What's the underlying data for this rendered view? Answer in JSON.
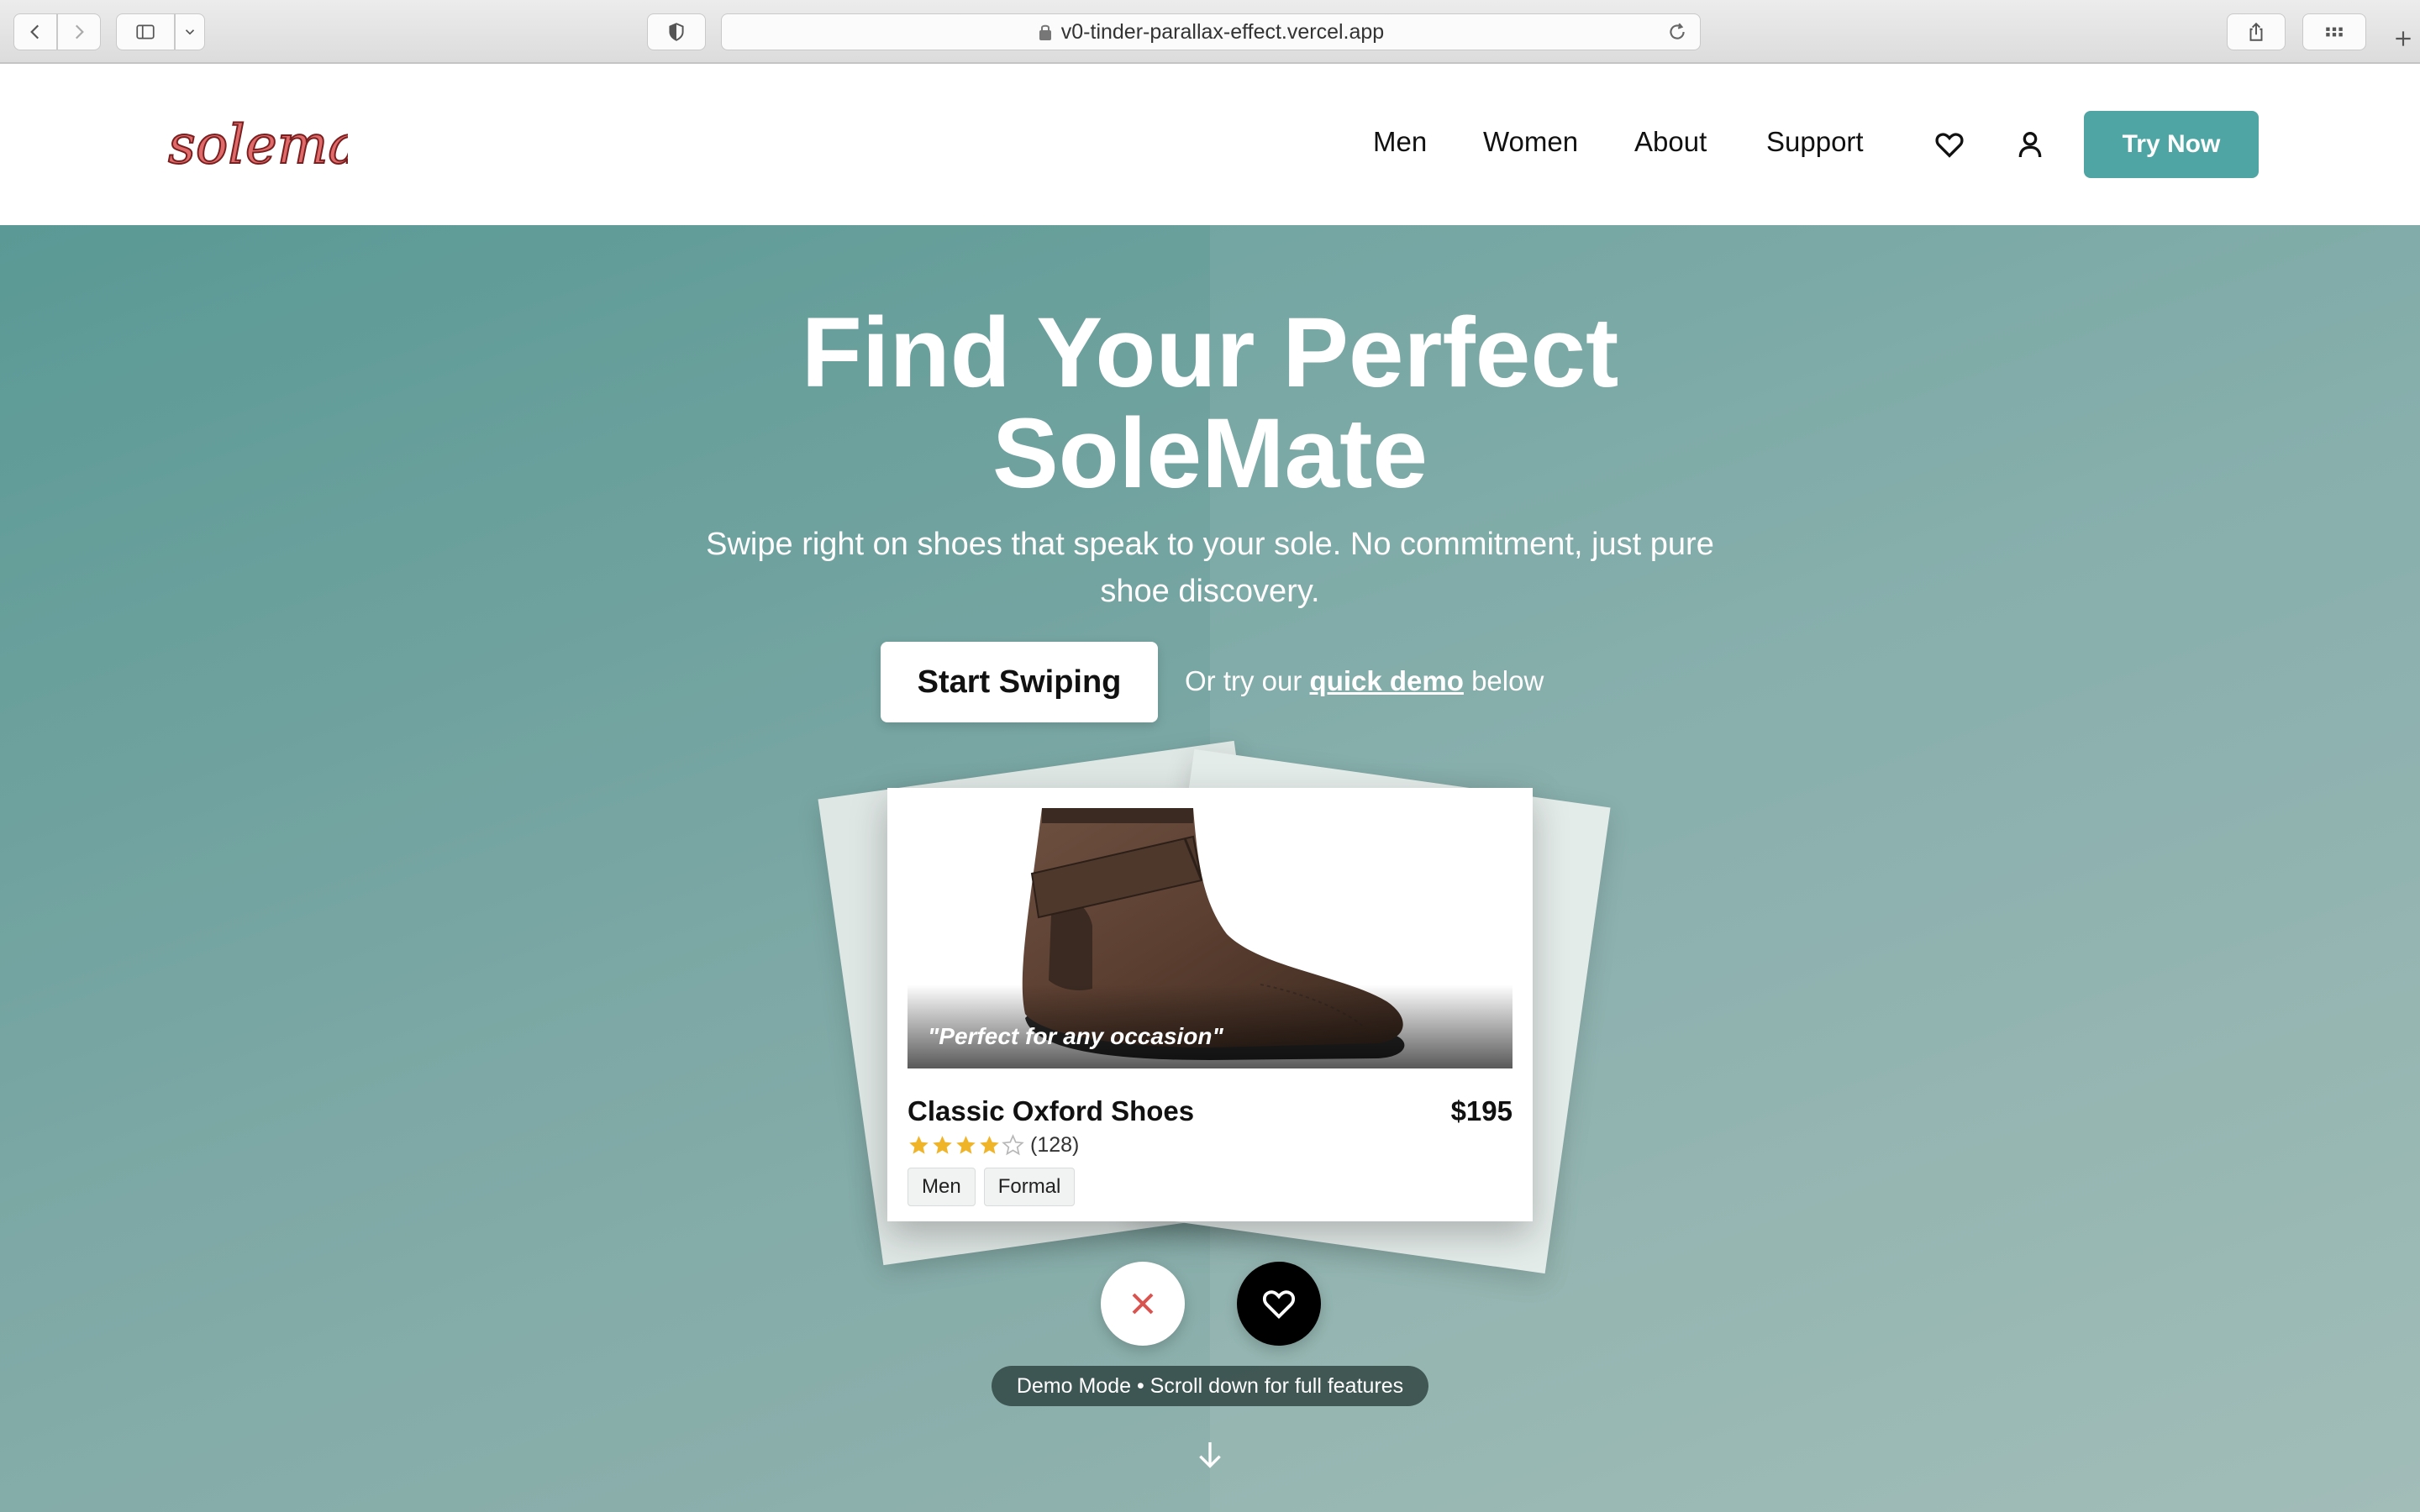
{
  "browser": {
    "url": "v0-tinder-parallax-effect.vercel.app"
  },
  "header": {
    "logo_text": "solemate",
    "nav": [
      "Men",
      "Women",
      "About",
      "Support"
    ],
    "cta_label": "Try Now",
    "accent_color": "#4fa5a3"
  },
  "hero": {
    "title_line1": "Find Your Perfect",
    "title_line2": "SoleMate",
    "subtitle_line1": "Swipe right on shoes that speak to your sole. No commitment, just pure",
    "subtitle_line2": "shoe discovery.",
    "start_label": "Start Swiping",
    "demo_prefix": "Or try our",
    "demo_link": "quick demo",
    "demo_suffix": "below"
  },
  "card": {
    "quote": "\"Perfect for any occasion\"",
    "name": "Classic Oxford Shoes",
    "price": "$195",
    "rating": 4,
    "rating_max": 5,
    "review_count": "(128)",
    "tags": [
      "Men",
      "Formal"
    ]
  },
  "demo_pill": "Demo Mode • Scroll down for full features",
  "colors": {
    "hero_start": "#5a9995",
    "hero_end": "#9bb8b3",
    "star": "#f0b429",
    "reject": "#d9534f"
  }
}
